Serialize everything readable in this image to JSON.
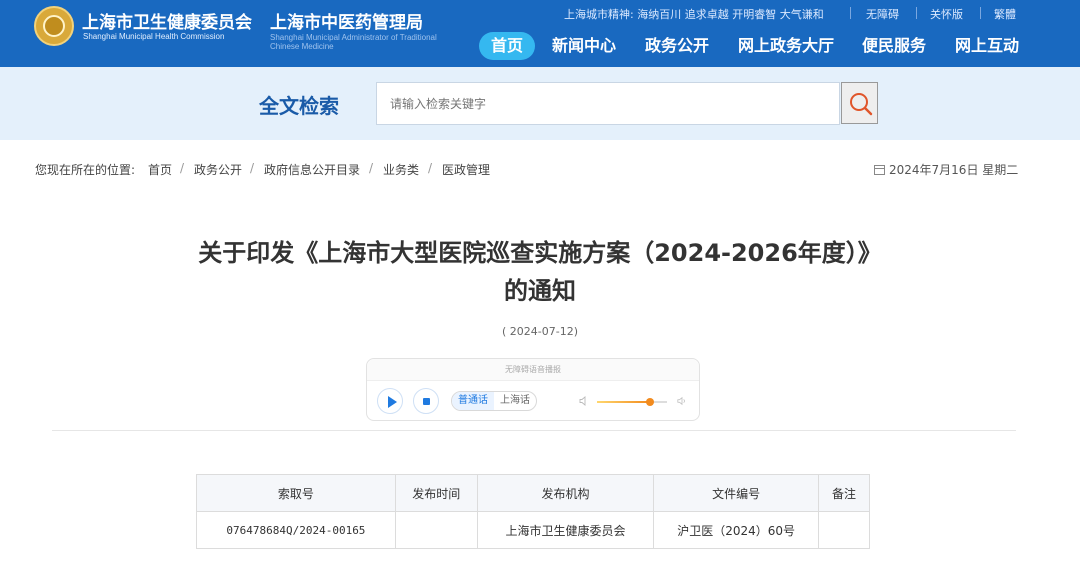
{
  "header": {
    "brand_primary": "上海市卫生健康委员会",
    "brand_primary_en": "Shanghai Municipal Health Commission",
    "brand_secondary": "上海市中医药管理局",
    "brand_secondary_en": "Shanghai Municipal Administrator of Traditional Chinese Medicine",
    "logo_text": "",
    "city_spirit": "上海城市精神: 海纳百川 追求卓越 开明睿智 大气谦和",
    "utils": [
      "无障碍",
      "关怀版",
      "繁體"
    ],
    "nav": [
      "首页",
      "新闻中心",
      "政务公开",
      "网上政务大厅",
      "便民服务",
      "网上互动"
    ],
    "active_nav": "首页"
  },
  "search": {
    "title": "全文检索",
    "placeholder": "请输入检索关键字",
    "button_icon": "search-icon"
  },
  "breadcrumb": {
    "label": "您现在所在的位置:",
    "items": [
      "首页",
      "政务公开",
      "政府信息公开目录",
      "业务类",
      "医政管理"
    ]
  },
  "date_today": "2024年7月16日 星期二",
  "article": {
    "title_line1": "关于印发《上海市大型医院巡查实施方案（2024-2026年度）》",
    "title_line2": "的通知",
    "pub_date": "( 2024-07-12)"
  },
  "player": {
    "caption": "无障碍语音播报",
    "languages": [
      "普通话",
      "上海话"
    ],
    "selected_language": "普通话",
    "volume": 0.75
  },
  "info_table": {
    "headers": [
      "索取号",
      "发布时间",
      "发布机构",
      "文件编号",
      "备注"
    ],
    "rows": [
      [
        "076478684Q/2024-00165",
        "",
        "上海市卫生健康委员会",
        "沪卫医（2024）60号",
        ""
      ]
    ]
  },
  "colors": {
    "header_bg": "#1969c0",
    "nav_active": "#35b8f0",
    "search_band": "#e4f0fb",
    "search_title": "#1a5ba8"
  }
}
